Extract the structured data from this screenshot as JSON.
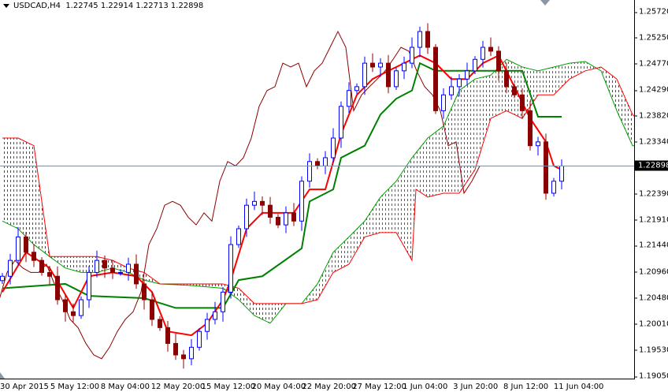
{
  "header": {
    "symbol": "USDCAD,H4",
    "ohlc": "1.22745 1.22914 1.22713 1.22898"
  },
  "price_axis": {
    "ticks": [
      "1.25720",
      "1.25250",
      "1.24770",
      "1.24290",
      "1.23820",
      "1.23340",
      "1.22390",
      "1.21910",
      "1.21440",
      "1.20960",
      "1.20480",
      "1.20010",
      "1.19530",
      "1.19050"
    ],
    "current_price": "1.22898",
    "range": [
      1.1905,
      1.2572
    ]
  },
  "time_axis": {
    "labels": [
      "30 Apr 2015",
      "5 May 12:00",
      "8 May 04:00",
      "12 May 20:00",
      "15 May 12:00",
      "20 May 04:00",
      "22 May 20:00",
      "27 May 12:00",
      "1 Jun 04:00",
      "3 Jun 20:00",
      "8 Jun 12:00",
      "11 Jun 04:00"
    ]
  },
  "colors": {
    "tenkan": "#ff0000",
    "kijun": "#008000",
    "bull_cloud": "#00a000",
    "bear_cloud": "#ff0000",
    "chikou": "#8b0000",
    "bull_candle": "#0000ff",
    "bear_candle": "#8b0000",
    "price_line": "#8090a0"
  },
  "chart_data": {
    "type": "candlestick",
    "closes": [
      1.2088,
      1.2117,
      1.216,
      1.2132,
      1.2117,
      1.2095,
      1.2088,
      1.2045,
      1.2023,
      1.2016,
      1.2045,
      1.2095,
      1.2117,
      1.2103,
      1.2095,
      1.2095,
      1.211,
      1.2074,
      1.2045,
      1.2009,
      1.1994,
      1.1965,
      1.1944,
      1.1937,
      1.1958,
      1.1987,
      1.2009,
      1.2023,
      1.2059,
      1.2146,
      1.2175,
      1.2218,
      1.2225,
      1.2218,
      1.2196,
      1.2182,
      1.2204,
      1.2189,
      1.2262,
      1.2298,
      1.229,
      1.2305,
      1.2341,
      1.2399,
      1.2428,
      1.2435,
      1.2478,
      1.2471,
      1.2478,
      1.2435,
      1.2464,
      1.2478,
      1.2507,
      1.2536,
      1.2507,
      1.2391,
      1.242,
      1.2435,
      1.2449,
      1.2464,
      1.2485,
      1.2507,
      1.25,
      1.2464,
      1.2435,
      1.242,
      1.2391,
      1.2327,
      1.2334,
      1.224,
      1.2262,
      1.22898
    ],
    "tenkan": [
      [
        0,
        1.2059
      ],
      [
        3,
        1.2132
      ],
      [
        6,
        1.2103
      ],
      [
        9,
        1.203
      ],
      [
        11,
        1.2088
      ],
      [
        14,
        1.2095
      ],
      [
        17,
        1.2088
      ],
      [
        19,
        1.2059
      ],
      [
        21,
        1.1987
      ],
      [
        24,
        1.198
      ],
      [
        26,
        1.2002
      ],
      [
        28,
        1.2045
      ],
      [
        29,
        1.2081
      ],
      [
        31,
        1.2175
      ],
      [
        33,
        1.2204
      ],
      [
        35,
        1.2204
      ],
      [
        37,
        1.2204
      ],
      [
        39,
        1.2247
      ],
      [
        41,
        1.2247
      ],
      [
        43,
        1.2348
      ],
      [
        45,
        1.242
      ],
      [
        47,
        1.2449
      ],
      [
        49,
        1.2464
      ],
      [
        51,
        1.2478
      ],
      [
        53,
        1.2492
      ],
      [
        55,
        1.2478
      ],
      [
        57,
        1.2449
      ],
      [
        59,
        1.2449
      ],
      [
        61,
        1.2478
      ],
      [
        63,
        1.2492
      ],
      [
        65,
        1.2435
      ],
      [
        67,
        1.2377
      ],
      [
        69,
        1.2334
      ],
      [
        70,
        1.229
      ],
      [
        71,
        1.2283
      ]
    ],
    "kijun": [
      [
        0,
        1.2066
      ],
      [
        5,
        1.2071
      ],
      [
        8,
        1.2074
      ],
      [
        11,
        1.2052
      ],
      [
        18,
        1.2048
      ],
      [
        22,
        1.203
      ],
      [
        28,
        1.203
      ],
      [
        30,
        1.2081
      ],
      [
        33,
        1.2088
      ],
      [
        38,
        1.2139
      ],
      [
        39,
        1.2225
      ],
      [
        42,
        1.2247
      ],
      [
        43,
        1.2305
      ],
      [
        46,
        1.2327
      ],
      [
        48,
        1.2384
      ],
      [
        50,
        1.2413
      ],
      [
        52,
        1.2428
      ],
      [
        53,
        1.2478
      ],
      [
        55,
        1.2464
      ],
      [
        60,
        1.2464
      ],
      [
        66,
        1.2464
      ],
      [
        68,
        1.238
      ],
      [
        71,
        1.238
      ]
    ],
    "span_a": [
      [
        0,
        1.2189
      ],
      [
        2,
        1.2175
      ],
      [
        4,
        1.2146
      ],
      [
        6,
        1.2124
      ],
      [
        8,
        1.2103
      ],
      [
        10,
        1.2095
      ],
      [
        12,
        1.2095
      ],
      [
        14,
        1.2103
      ],
      [
        16,
        1.2095
      ],
      [
        18,
        1.2081
      ],
      [
        20,
        1.2074
      ],
      [
        24,
        1.2071
      ],
      [
        28,
        1.2066
      ],
      [
        30,
        1.2045
      ],
      [
        32,
        1.2016
      ],
      [
        34,
        1.2002
      ],
      [
        36,
        1.2038
      ],
      [
        38,
        1.2038
      ],
      [
        40,
        1.2074
      ],
      [
        42,
        1.2132
      ],
      [
        44,
        1.216
      ],
      [
        46,
        1.2189
      ],
      [
        48,
        1.2233
      ],
      [
        50,
        1.2262
      ],
      [
        52,
        1.2305
      ],
      [
        54,
        1.2341
      ],
      [
        56,
        1.2363
      ],
      [
        58,
        1.2428
      ],
      [
        60,
        1.2449
      ],
      [
        62,
        1.2456
      ],
      [
        64,
        1.2485
      ],
      [
        66,
        1.2471
      ],
      [
        68,
        1.2464
      ],
      [
        70,
        1.2471
      ],
      [
        72,
        1.2478
      ],
      [
        74,
        1.2481
      ],
      [
        76,
        1.2464
      ],
      [
        78,
        1.2391
      ],
      [
        80,
        1.2327
      ],
      [
        80.5,
        1.2327
      ]
    ],
    "span_b": [
      [
        0,
        1.2341
      ],
      [
        2,
        1.2341
      ],
      [
        4,
        1.2327
      ],
      [
        6,
        1.2124
      ],
      [
        8,
        1.2124
      ],
      [
        10,
        1.2124
      ],
      [
        12,
        1.2124
      ],
      [
        14,
        1.2117
      ],
      [
        16,
        1.2103
      ],
      [
        18,
        1.2095
      ],
      [
        20,
        1.2074
      ],
      [
        24,
        1.2074
      ],
      [
        28,
        1.2074
      ],
      [
        30,
        1.2066
      ],
      [
        32,
        1.2038
      ],
      [
        34,
        1.2038
      ],
      [
        36,
        1.2038
      ],
      [
        38,
        1.2038
      ],
      [
        40,
        1.2045
      ],
      [
        42,
        1.2095
      ],
      [
        44,
        1.211
      ],
      [
        46,
        1.216
      ],
      [
        48,
        1.2168
      ],
      [
        50,
        1.2168
      ],
      [
        52,
        1.2117
      ],
      [
        52.5,
        1.2247
      ],
      [
        54,
        1.2233
      ],
      [
        56,
        1.224
      ],
      [
        58,
        1.224
      ],
      [
        60,
        1.2283
      ],
      [
        62,
        1.2377
      ],
      [
        64,
        1.2391
      ],
      [
        66,
        1.2377
      ],
      [
        68,
        1.242
      ],
      [
        70,
        1.242
      ],
      [
        72,
        1.2449
      ],
      [
        74,
        1.2464
      ],
      [
        76,
        1.2471
      ],
      [
        78,
        1.2449
      ],
      [
        80,
        1.2384
      ],
      [
        80.5,
        1.2377
      ]
    ],
    "chikou_shift": 10.4
  }
}
